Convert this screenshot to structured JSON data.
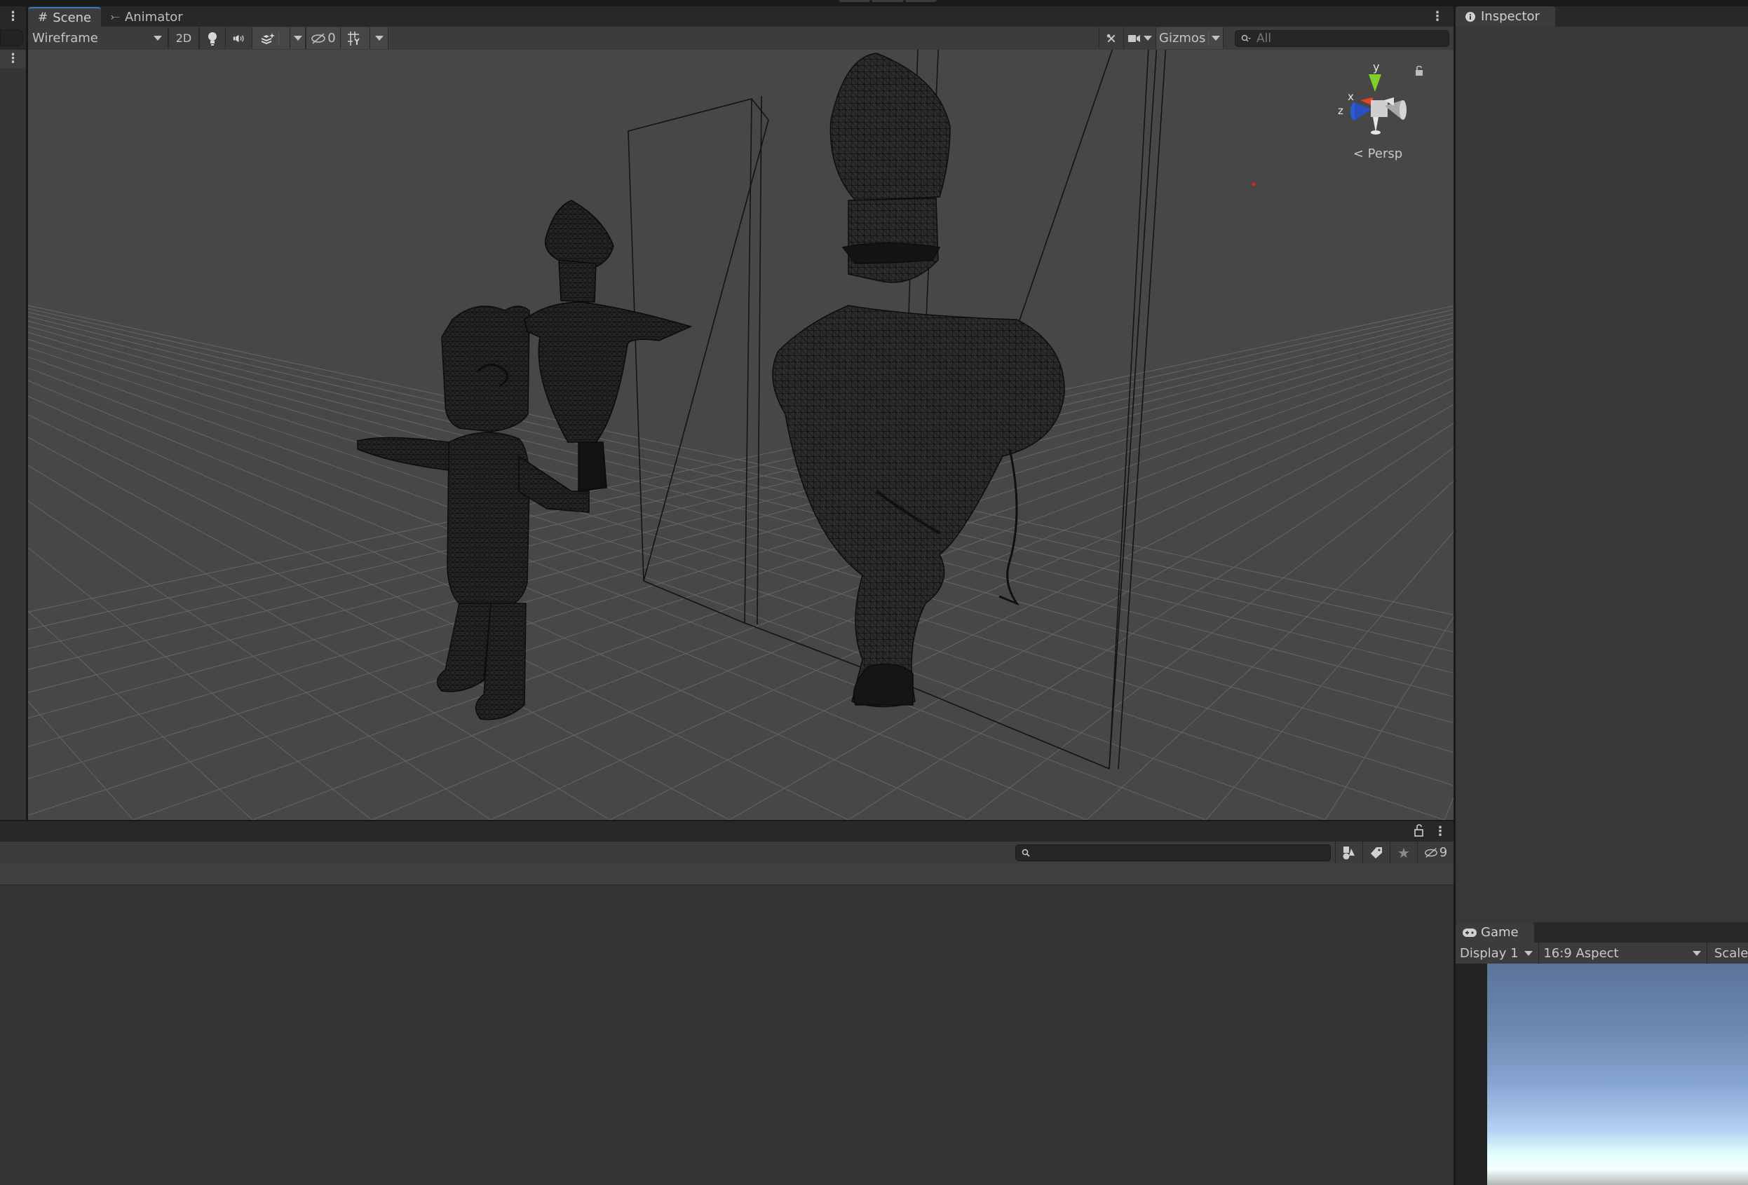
{
  "window": {
    "play_controls": [
      "play",
      "pause",
      "step"
    ]
  },
  "left_strip": {
    "menu_icon": "kebab-icon",
    "row_menu_icon": "kebab-icon"
  },
  "scene_panel": {
    "tabs": [
      {
        "label": "Scene",
        "icon": "grid-hash-icon",
        "active": true
      },
      {
        "label": "Animator",
        "icon": "animator-icon",
        "active": false
      }
    ],
    "more_icon": "kebab-icon",
    "toolbar": {
      "draw_mode": "Wireframe",
      "toggle_2d": "2D",
      "lighting_icon": "light-bulb-icon",
      "audio_icon": "speaker-icon",
      "effects_icon": "effects-layers-icon",
      "hidden_count": "0",
      "grid_snap_icon": "grid-y-icon",
      "tools_icon": "wrench-cross-icon",
      "camera_icon": "camera-icon",
      "gizmos_label": "Gizmos",
      "search_placeholder": "All"
    },
    "view": {
      "orientation_gizmo": {
        "axes": {
          "y": "y",
          "x": "x",
          "z": "z"
        },
        "colors": {
          "y": "#7fd02c",
          "x": "#e5441f",
          "z": "#2f5bd6",
          "neutral": "#d0d0d0"
        },
        "projection_label": "Persp"
      },
      "grid_color": "#8a8a8a",
      "wire_color": "#151515",
      "background": "#474747"
    }
  },
  "project_panel": {
    "lock_icon": "lock-open-icon",
    "menu_icon": "kebab-icon",
    "search_placeholder": "",
    "filter_buttons": [
      {
        "icon": "search-by-type-icon"
      },
      {
        "icon": "search-by-label-icon"
      },
      {
        "icon": "favorites-star-icon"
      }
    ],
    "hidden_packages_count": "9"
  },
  "inspector": {
    "tab_label": "Inspector",
    "tab_icon": "info-icon"
  },
  "game_panel": {
    "tab_label": "Game",
    "tab_icon": "gamepad-icon",
    "display": "Display 1",
    "aspect": "16:9 Aspect",
    "scale_label": "Scale"
  }
}
